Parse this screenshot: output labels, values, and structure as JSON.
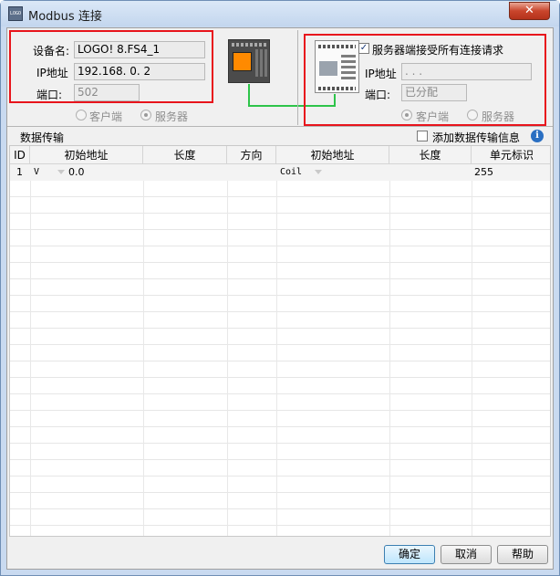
{
  "window": {
    "title": "Modbus 连接",
    "app_icon_text": "LOGO",
    "close_glyph": "✕"
  },
  "local": {
    "device_name_label": "设备名:",
    "device_name_value": "LOGO! 8.FS4_1",
    "ip_label": "IP地址",
    "ip_value": "192.168. 0. 2",
    "port_label": "端口:",
    "port_value": "502",
    "radio_client": "客户端",
    "radio_server": "服务器",
    "radio_server_checked": true
  },
  "remote": {
    "accept_all_label": "服务器端接受所有连接请求",
    "accept_all_checked": true,
    "ip_label": "IP地址",
    "ip_value": " .  .  . ",
    "port_label": "端口:",
    "port_value": "已分配",
    "radio_client": "客户端",
    "radio_server": "服务器",
    "radio_client_checked": true
  },
  "transfer": {
    "section_title": "数据传输",
    "add_info_label": "添加数据传输信息",
    "help_glyph": "i",
    "columns": [
      "ID",
      "初始地址",
      "长度",
      "方向",
      "初始地址",
      "长度",
      "单元标识"
    ],
    "rows": [
      {
        "id": "1",
        "type": "V",
        "start": "0.0",
        "length": "",
        "direction": "",
        "remote_type": "Coil",
        "remote_length": "",
        "unit_id": "255"
      }
    ]
  },
  "buttons": {
    "ok": "确定",
    "cancel": "取消",
    "help": "帮助"
  },
  "colors": {
    "highlight_box": "#e8141c",
    "link_line": "#2ec44a",
    "device_screen": "#ff8a00"
  }
}
